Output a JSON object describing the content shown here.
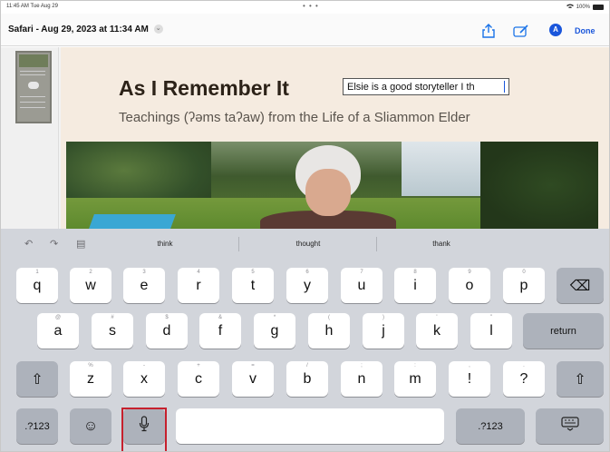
{
  "status_bar": {
    "time": "11:45 AM  Tue Aug 29",
    "dots": "• • •",
    "battery": "100%"
  },
  "toolbar": {
    "title": "Safari - Aug 29, 2023 at 11:34 AM",
    "chevron": "⌄",
    "share_icon": "share-icon",
    "markup_icon": "markup-icon",
    "pen_label": "A",
    "done_label": "Done",
    "accent_color": "#1a56db"
  },
  "page": {
    "title": "As I Remember It",
    "subtitle": "Teachings (ʔəms taʔaw) from the Life of a Sliammon Elder",
    "input_value": "Elsie is a good storyteller I th"
  },
  "keyboard": {
    "toolbar_icons": {
      "undo": "↶",
      "redo": "↷",
      "paste": "▤"
    },
    "suggestions": [
      "think",
      "thought",
      "thank"
    ],
    "row1": [
      {
        "main": "q",
        "alt": "1"
      },
      {
        "main": "w",
        "alt": "2"
      },
      {
        "main": "e",
        "alt": "3"
      },
      {
        "main": "r",
        "alt": "4"
      },
      {
        "main": "t",
        "alt": "5"
      },
      {
        "main": "y",
        "alt": "6"
      },
      {
        "main": "u",
        "alt": "7"
      },
      {
        "main": "i",
        "alt": "8"
      },
      {
        "main": "o",
        "alt": "9"
      },
      {
        "main": "p",
        "alt": "0"
      }
    ],
    "row2": [
      {
        "main": "a",
        "alt": "@"
      },
      {
        "main": "s",
        "alt": "#"
      },
      {
        "main": "d",
        "alt": "$"
      },
      {
        "main": "f",
        "alt": "&"
      },
      {
        "main": "g",
        "alt": "*"
      },
      {
        "main": "h",
        "alt": "("
      },
      {
        "main": "j",
        "alt": ")"
      },
      {
        "main": "k",
        "alt": "'"
      },
      {
        "main": "l",
        "alt": "\""
      }
    ],
    "row3": [
      {
        "main": "z",
        "alt": "%"
      },
      {
        "main": "x",
        "alt": "-"
      },
      {
        "main": "c",
        "alt": "+"
      },
      {
        "main": "v",
        "alt": "="
      },
      {
        "main": "b",
        "alt": "/"
      },
      {
        "main": "n",
        "alt": ";"
      },
      {
        "main": "m",
        "alt": ":"
      },
      {
        "main": "!",
        "alt": ","
      },
      {
        "main": "?",
        "alt": "."
      }
    ],
    "backspace": "⌫",
    "return_label": "return",
    "shift": "⇧",
    "numbers_label": ".?123",
    "numbers_label_right": ".?123",
    "emoji": "☺",
    "mic": "🎙",
    "hide_keyboard": "⌨"
  },
  "colors": {
    "highlight_box": "#c6202d",
    "page_background": "#f5ebe0",
    "keyboard_background": "#d2d5db"
  }
}
